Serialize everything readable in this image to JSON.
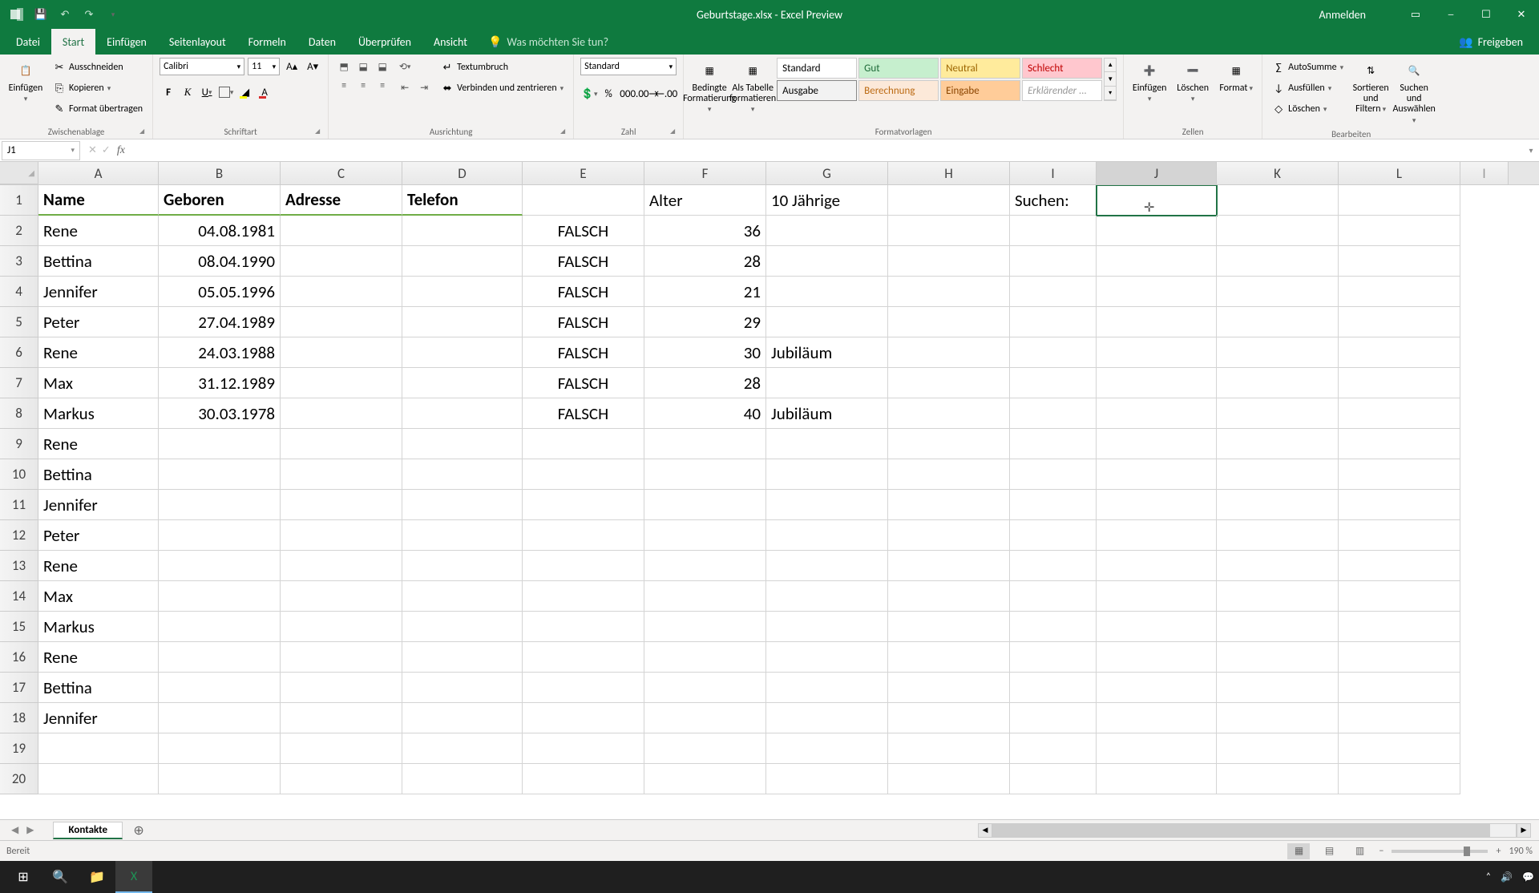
{
  "titlebar": {
    "title": "Geburtstage.xlsx - Excel Preview",
    "signin": "Anmelden"
  },
  "ribbon": {
    "tabs": [
      "Datei",
      "Start",
      "Einfügen",
      "Seitenlayout",
      "Formeln",
      "Daten",
      "Überprüfen",
      "Ansicht"
    ],
    "active_tab": "Start",
    "tell_me": "Was möchten Sie tun?",
    "share": "Freigeben",
    "groups": {
      "clipboard": {
        "label": "Zwischenablage",
        "paste": "Einfügen",
        "cut": "Ausschneiden",
        "copy": "Kopieren",
        "format": "Format übertragen"
      },
      "font": {
        "label": "Schriftart",
        "name": "Calibri",
        "size": "11"
      },
      "align": {
        "label": "Ausrichtung",
        "wrap": "Textumbruch",
        "merge": "Verbinden und zentrieren"
      },
      "number": {
        "label": "Zahl",
        "format": "Standard"
      },
      "styles": {
        "label": "Formatvorlagen",
        "cond": "Bedingte Formatierung",
        "table": "Als Tabelle formatieren",
        "cells": [
          "Standard",
          "Gut",
          "Neutral",
          "Schlecht",
          "Ausgabe",
          "Berechnung",
          "Eingabe",
          "Erklärender ..."
        ]
      },
      "cells": {
        "label": "Zellen",
        "insert": "Einfügen",
        "delete": "Löschen",
        "format": "Format"
      },
      "editing": {
        "label": "Bearbeiten",
        "autosum": "AutoSumme",
        "fill": "Ausfüllen",
        "clear": "Löschen",
        "sort": "Sortieren und Filtern",
        "find": "Suchen und Auswählen"
      }
    }
  },
  "namebox": "J1",
  "columns": [
    "A",
    "B",
    "C",
    "D",
    "E",
    "F",
    "G",
    "H",
    "I",
    "J",
    "K",
    "L"
  ],
  "selected_col": "J",
  "headers": {
    "A": "Name",
    "B": "Geboren",
    "C": "Adresse",
    "D": "Telefon",
    "F": "Alter",
    "G": "10 Jährige",
    "I": "Suchen:"
  },
  "data_rows": [
    {
      "A": "Rene",
      "B": "04.08.1981",
      "E": "FALSCH",
      "F": "36"
    },
    {
      "A": "Bettina",
      "B": "08.04.1990",
      "E": "FALSCH",
      "F": "28"
    },
    {
      "A": "Jennifer",
      "B": "05.05.1996",
      "E": "FALSCH",
      "F": "21"
    },
    {
      "A": "Peter",
      "B": "27.04.1989",
      "E": "FALSCH",
      "F": "29"
    },
    {
      "A": "Rene",
      "B": "24.03.1988",
      "E": "FALSCH",
      "F": "30",
      "G": "Jubiläum"
    },
    {
      "A": "Max",
      "B": "31.12.1989",
      "E": "FALSCH",
      "F": "28"
    },
    {
      "A": "Markus",
      "B": "30.03.1978",
      "E": "FALSCH",
      "F": "40",
      "G": "Jubiläum"
    },
    {
      "A": "Rene"
    },
    {
      "A": "Bettina"
    },
    {
      "A": "Jennifer"
    },
    {
      "A": "Peter"
    },
    {
      "A": "Rene"
    },
    {
      "A": "Max"
    },
    {
      "A": "Markus"
    },
    {
      "A": "Rene"
    },
    {
      "A": "Bettina"
    },
    {
      "A": "Jennifer"
    },
    {},
    {}
  ],
  "sheet": {
    "active": "Kontakte"
  },
  "status": {
    "ready": "Bereit",
    "zoom": "190 %"
  }
}
